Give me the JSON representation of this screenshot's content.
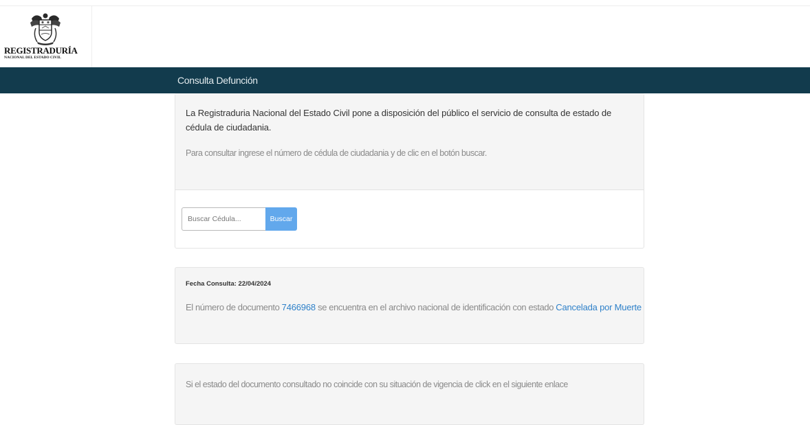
{
  "logo": {
    "crest_icon": "colombian-coat-of-arms-icon",
    "title": "REGISTRADURÍA",
    "subtitle": "NACIONAL DEL ESTADO CIVIL"
  },
  "navbar": {
    "title": "Consulta Defunción",
    "background": "#123b4d"
  },
  "intro": {
    "main": "La Registraduria Nacional del Estado Civil pone a disposición del público el servicio de consulta de estado de cédula de ciudadania.",
    "sub": "Para consultar ingrese el número de cédula de ciudadania y de clic en el botón buscar."
  },
  "search": {
    "placeholder": "Buscar Cédula...",
    "value": "",
    "button_label": "Buscar",
    "button_color": "#62a8ec"
  },
  "result": {
    "date_label": "Fecha Consulta:",
    "date_value": "22/04/2024",
    "text_before": "El número de documento ",
    "document_number": "7466968",
    "text_middle": " se encuentra en el archivo nacional de identificación con estado ",
    "status": "Cancelada por Muerte",
    "link_color": "#2f81c9"
  },
  "bottom": {
    "text": "Si el estado del documento consultado no coincide con su situación de vigencia de click en el siguiente enlace"
  }
}
